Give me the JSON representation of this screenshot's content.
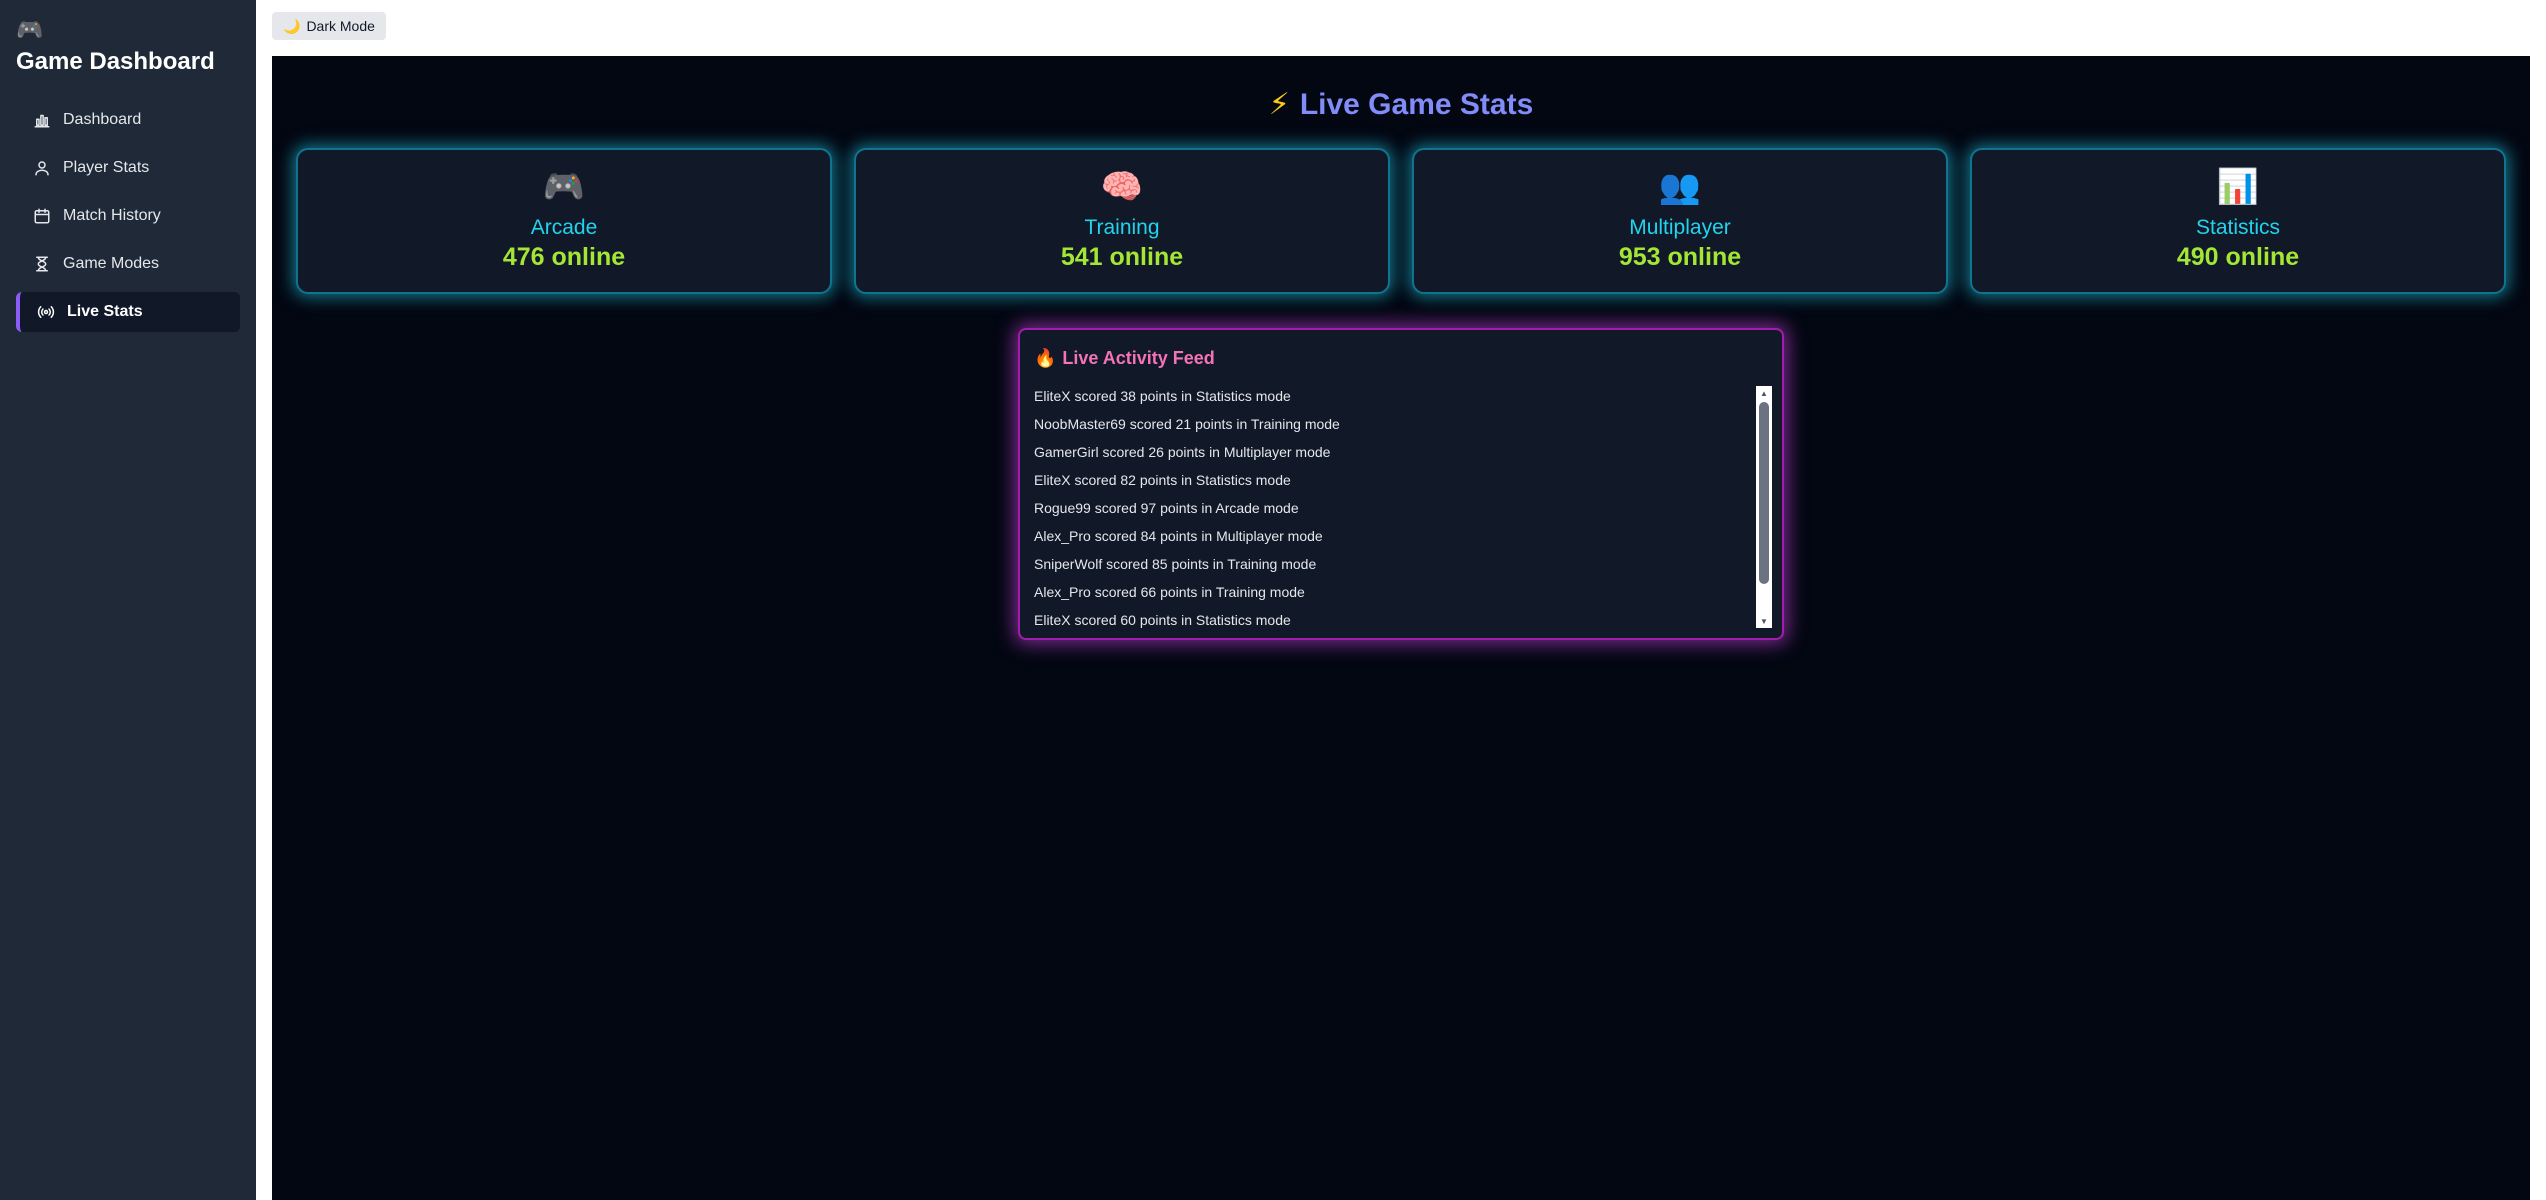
{
  "sidebar": {
    "brand_icon": "🎮",
    "brand_title": "Game Dashboard",
    "items": [
      {
        "label": "Dashboard",
        "icon": "bar-chart-icon",
        "active": false
      },
      {
        "label": "Player Stats",
        "icon": "user-icon",
        "active": false
      },
      {
        "label": "Match History",
        "icon": "calendar-icon",
        "active": false
      },
      {
        "label": "Game Modes",
        "icon": "hourglass-icon",
        "active": false
      },
      {
        "label": "Live Stats",
        "icon": "broadcast-icon",
        "active": true
      }
    ],
    "accent_color": "#8b5cf6"
  },
  "toolbar": {
    "theme_toggle_icon": "🌙",
    "theme_toggle_label": "Dark Mode"
  },
  "main": {
    "title_icon": "⚡",
    "title": "Live Game Stats",
    "cards": [
      {
        "icon": "🎮",
        "title": "Arcade",
        "count": "476 online"
      },
      {
        "icon": "🧠",
        "title": "Training",
        "count": "541 online"
      },
      {
        "icon": "👥",
        "title": "Multiplayer",
        "count": "953 online"
      },
      {
        "icon": "📊",
        "title": "Statistics",
        "count": "490 online"
      }
    ],
    "feed": {
      "icon": "🔥",
      "title": "Live Activity Feed",
      "items": [
        "EliteX scored 38 points in Statistics mode",
        "NoobMaster69 scored 21 points in Training mode",
        "GamerGirl scored 26 points in Multiplayer mode",
        "EliteX scored 82 points in Statistics mode",
        "Rogue99 scored 97 points in Arcade mode",
        "Alex_Pro scored 84 points in Multiplayer mode",
        "SniperWolf scored 85 points in Training mode",
        "Alex_Pro scored 66 points in Training mode",
        "EliteX scored 60 points in Statistics mode"
      ]
    }
  },
  "colors": {
    "sidebar_bg": "#1f2937",
    "main_bg": "#030712",
    "card_glow": "#22d3ee",
    "feed_glow": "#d946ef",
    "count_color": "#a3e635",
    "title_color": "#818cf8"
  }
}
